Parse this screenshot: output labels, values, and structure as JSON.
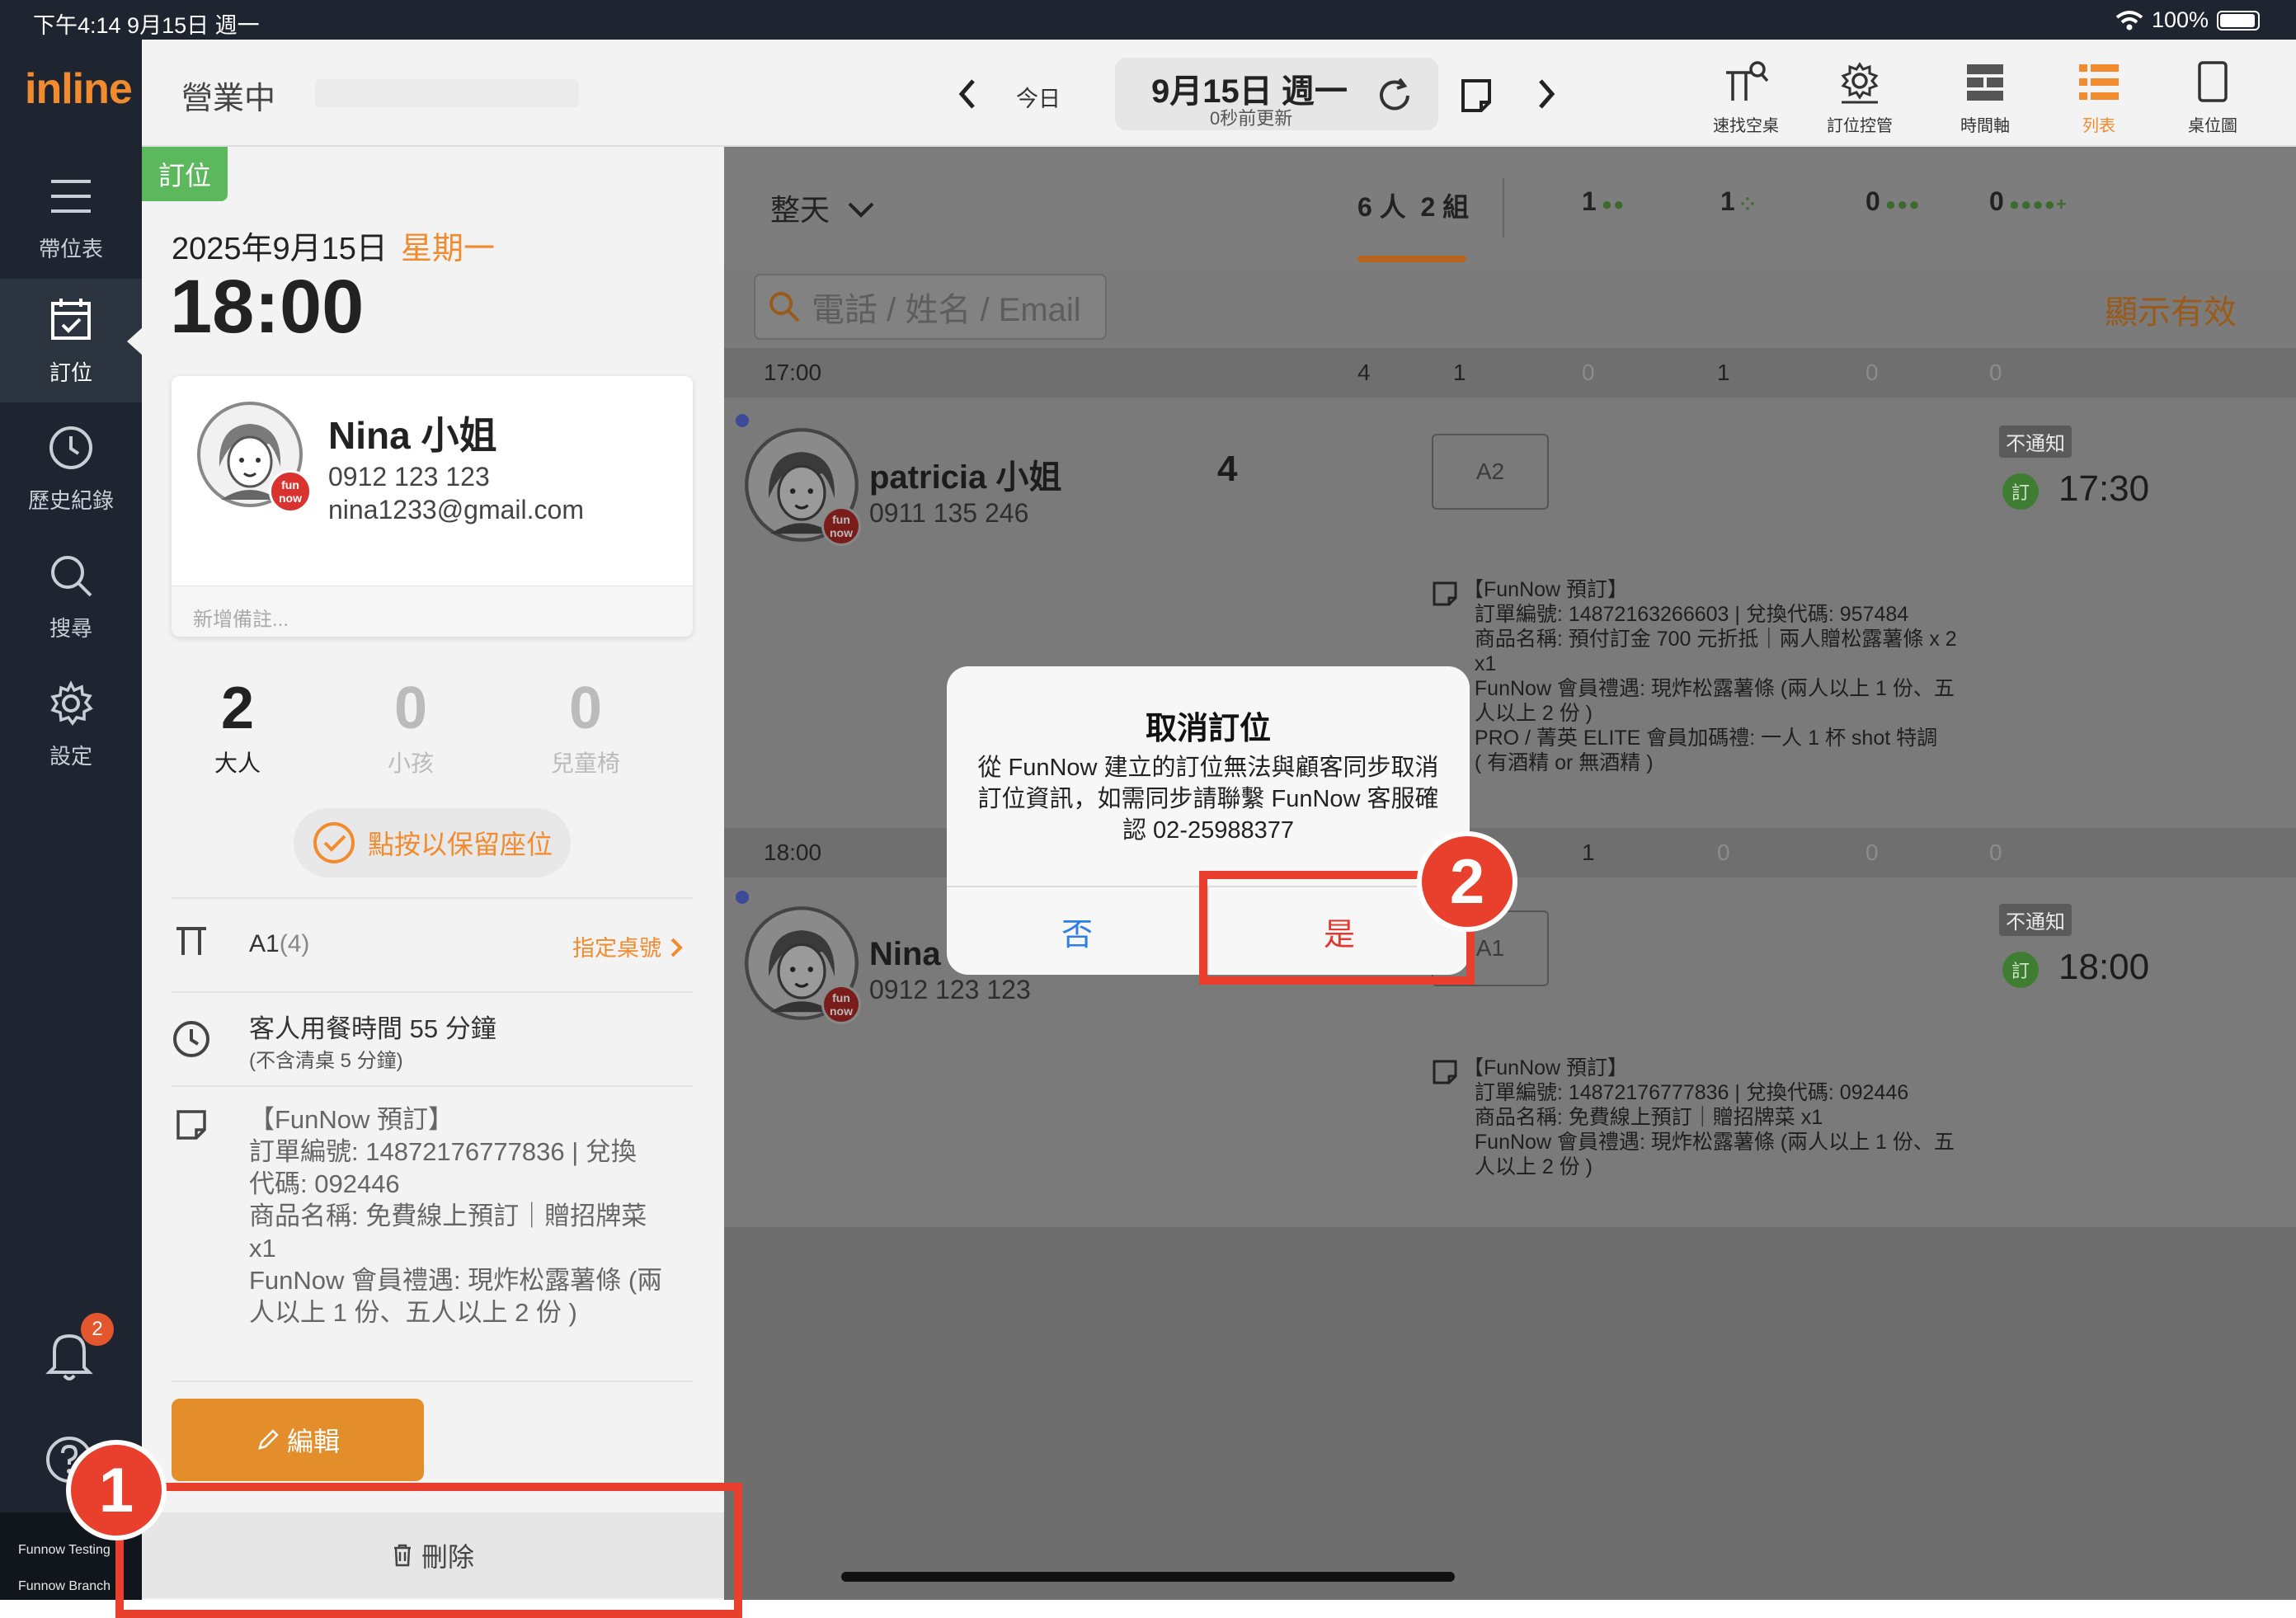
{
  "status_bar": {
    "time_date": "下午4:14   9月15日 週一",
    "battery": "100%"
  },
  "nav": {
    "logo": "inline",
    "items": [
      {
        "label": "帶位表",
        "icon": "menu-icon"
      },
      {
        "label": "訂位",
        "icon": "calendar-check-icon"
      },
      {
        "label": "歷史紀錄",
        "icon": "clock-icon"
      },
      {
        "label": "搜尋",
        "icon": "search-icon"
      },
      {
        "label": "設定",
        "icon": "gear-icon"
      }
    ],
    "notification_count": "2",
    "branch_line1": "Funnow Testing",
    "branch_line2": "Funnow Branch"
  },
  "topbar": {
    "status": "營業中",
    "today": "今日",
    "date": "9月15日 週一",
    "updated": "0秒前更新",
    "tools": [
      {
        "label": "速找空桌",
        "icon": "find-table-icon"
      },
      {
        "label": "訂位控管",
        "icon": "booking-control-icon"
      },
      {
        "label": "時間軸",
        "icon": "timeline-icon"
      },
      {
        "label": "列表",
        "icon": "list-icon",
        "active": true
      },
      {
        "label": "桌位圖",
        "icon": "table-map-icon"
      }
    ]
  },
  "detail": {
    "tag": "訂位",
    "date": "2025年9月15日",
    "weekday": "星期一",
    "time": "18:00",
    "guest": {
      "name": "Nina 小姐",
      "phone": "0912 123 123",
      "email": "nina1233@gmail.com",
      "memo_placeholder": "新增備註..."
    },
    "counts": [
      {
        "value": "2",
        "label": "大人"
      },
      {
        "value": "0",
        "label": "小孩"
      },
      {
        "value": "0",
        "label": "兒童椅"
      }
    ],
    "hold_seat": "點按以保留座位",
    "table": "A1",
    "table_capacity": "(4)",
    "assign_table": "指定桌號",
    "dine_time": "客人用餐時間 55 分鐘",
    "dine_sub": "(不含清桌 5 分鐘)",
    "note": [
      "【FunNow 預訂】",
      "訂單編號: 14872176777836 | 兌換",
      "代碼: 092446",
      "商品名稱: 免費線上預訂｜贈招牌菜",
      "x1",
      "FunNow 會員禮遇: 現炸松露薯條 (兩",
      "人以上 1 份、五人以上 2 份 )"
    ],
    "edit": "編輯",
    "delete": "刪除"
  },
  "list": {
    "period": "整天",
    "total_people": "6 人",
    "total_groups": "2 組",
    "stat_counts": [
      "1",
      "1",
      "0",
      "0"
    ],
    "search_placeholder": "電話 / 姓名 / Email",
    "show_valid": "顯示有效",
    "slots": [
      {
        "time": "17:00",
        "stats": [
          "4",
          "1",
          "0",
          "1",
          "0",
          "0"
        ],
        "reservation": {
          "name": "patricia 小姐",
          "phone": "0911 135 246",
          "party": "4",
          "table": "A2",
          "notify": "不通知",
          "booked": "訂",
          "time": "17:30",
          "note": [
            "【FunNow 預訂】",
            "  訂單編號: 14872163266603 | 兌換代碼: 957484",
            "  商品名稱: 預付訂金 700 元折抵｜兩人贈松露薯條 x 2",
            "  x1",
            "  FunNow 會員禮遇: 現炸松露薯條 (兩人以上 1 份、五",
            "  人以上 2 份 )",
            "  PRO / 菁英 ELITE 會員加碼禮: 一人 1 杯 shot 特調",
            "  ( 有酒精 or 無酒精 )"
          ]
        }
      },
      {
        "time": "18:00",
        "stats": [
          "1",
          "0",
          "0",
          "0"
        ],
        "reservation": {
          "name": "Nina 小姐",
          "phone": "0912 123 123",
          "table": "A1",
          "notify": "不通知",
          "booked": "訂",
          "time": "18:00",
          "note": [
            "【FunNow 預訂】",
            "  訂單編號: 14872176777836 | 兌換代碼: 092446",
            "  商品名稱: 免費線上預訂｜贈招牌菜 x1",
            "  FunNow 會員禮遇: 現炸松露薯條 (兩人以上 1 份、五",
            "  人以上 2 份 )"
          ]
        }
      }
    ]
  },
  "dialog": {
    "title": "取消訂位",
    "message": "從 FunNow 建立的訂位無法與顧客同步取消訂位資訊，如需同步請聯繫 FunNow 客服確認 02-25988377",
    "no": "否",
    "yes": "是"
  },
  "annotations": {
    "step1": "1",
    "step2": "2",
    "color": "#e8402c"
  },
  "funnow_badge": "fun\nnow"
}
